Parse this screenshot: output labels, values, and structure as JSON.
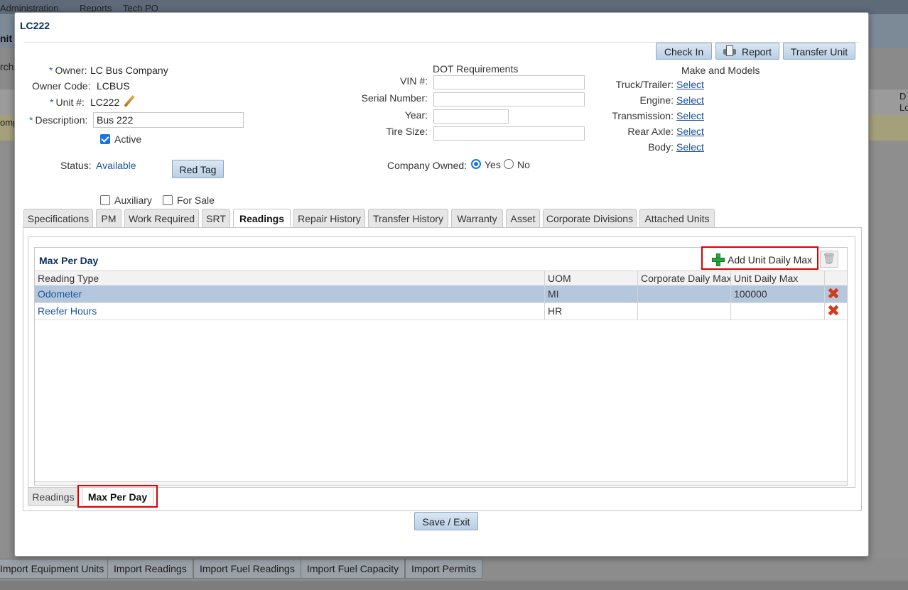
{
  "background": {
    "menu": [
      "Administration",
      "Reports",
      "Tech PO"
    ],
    "left_fragments": [
      "nit I",
      "rch",
      "omp"
    ],
    "right_fragments": [
      "D",
      "Lo"
    ],
    "bottom_buttons": [
      "Import Equipment Units",
      "Import Readings",
      "Import Fuel Readings",
      "Import Fuel Capacity",
      "Import Permits"
    ]
  },
  "modal": {
    "title": "LC222",
    "actions": {
      "check_in": "Check In",
      "report": "Report",
      "transfer_unit": "Transfer Unit"
    },
    "owner": {
      "label": "Owner:",
      "value": "LC Bus Company"
    },
    "owner_code": {
      "label": "Owner Code:",
      "value": "LCBUS"
    },
    "unit": {
      "label": "Unit #:",
      "value": "LC222"
    },
    "description": {
      "label": "Description:",
      "value": "Bus 222"
    },
    "active_label": "Active",
    "status": {
      "label": "Status:",
      "value": "Available"
    },
    "red_tag": "Red Tag",
    "auxiliary_label": "Auxiliary",
    "for_sale_label": "For Sale",
    "dot": {
      "title": "DOT Requirements",
      "vin_label": "VIN #:",
      "serial_label": "Serial Number:",
      "year_label": "Year:",
      "tire_label": "Tire Size:",
      "company_owned_label": "Company Owned:",
      "yes": "Yes",
      "no": "No"
    },
    "make_models": {
      "title": "Make and Models",
      "rows": [
        {
          "label": "Truck/Trailer:",
          "link": "Select"
        },
        {
          "label": "Engine:",
          "link": "Select"
        },
        {
          "label": "Transmission:",
          "link": "Select"
        },
        {
          "label": "Rear Axle:",
          "link": "Select"
        },
        {
          "label": "Body:",
          "link": "Select"
        }
      ]
    },
    "tabs": [
      "Specifications",
      "PM",
      "Work Required",
      "SRT",
      "Readings",
      "Repair History",
      "Transfer History",
      "Warranty",
      "Asset",
      "Corporate Divisions",
      "Attached Units"
    ],
    "active_tab": "Readings",
    "grid": {
      "title": "Max Per Day",
      "add_label": "Add Unit Daily Max",
      "columns": [
        "Reading Type",
        "UOM",
        "Corporate Daily Max",
        "Unit Daily Max"
      ],
      "rows": [
        {
          "type": "Odometer",
          "uom": "MI",
          "corporate": "",
          "unit": "100000"
        },
        {
          "type": "Reefer Hours",
          "uom": "HR",
          "corporate": "",
          "unit": ""
        }
      ]
    },
    "sub_tabs": [
      "Readings",
      "Max Per Day"
    ],
    "save_exit": "Save / Exit"
  }
}
